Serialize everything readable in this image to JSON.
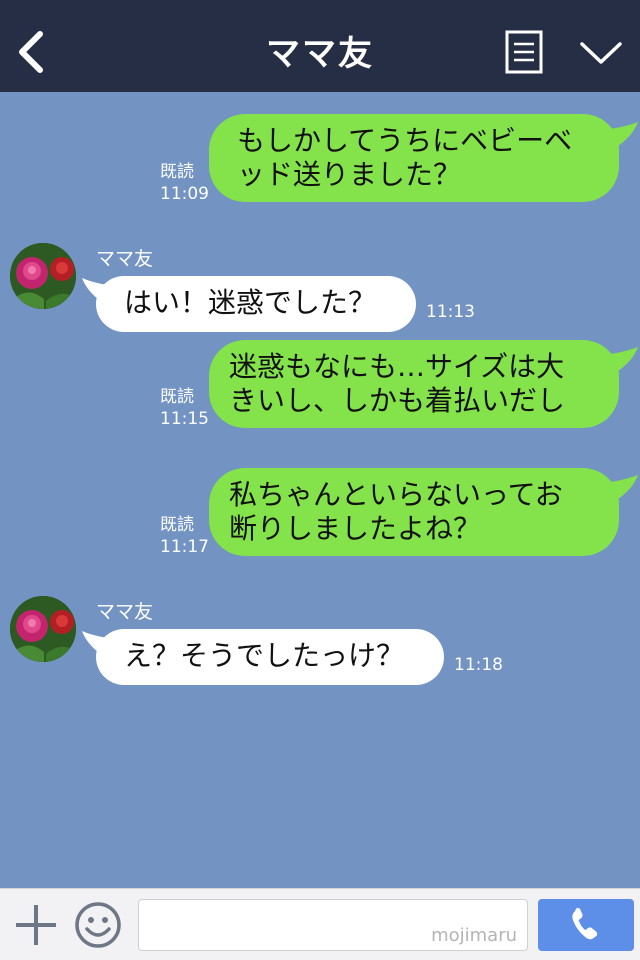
{
  "header": {
    "title": "ママ友"
  },
  "messages": [
    {
      "type": "sent",
      "lines": [
        "もしかしてうちにベビーベ",
        "ッド送りました？"
      ],
      "read_label": "既読",
      "time": "11:09"
    },
    {
      "type": "received",
      "sender": "ママ友",
      "lines": [
        "はい！迷惑でした？"
      ],
      "time": "11:13"
    },
    {
      "type": "sent",
      "lines": [
        "迷惑もなにも…サイズは大",
        "きいし、しかも着払いだし"
      ],
      "read_label": "既読",
      "time": "11:15"
    },
    {
      "type": "sent",
      "lines": [
        "私ちゃんといらないってお",
        "断りしましたよね？"
      ],
      "read_label": "既読",
      "time": "11:17"
    },
    {
      "type": "received",
      "sender": "ママ友",
      "lines": [
        "え？そうでしたっけ？"
      ],
      "time": "11:18"
    }
  ],
  "footer": {
    "watermark": "mojimaru"
  },
  "icons": {
    "back": "chevron-left-icon",
    "menu": "list-icon",
    "collapse": "chevron-down-icon",
    "plus": "plus-icon",
    "emoji": "smiley-icon",
    "call": "phone-icon"
  },
  "colors": {
    "header_bg": "#252e44",
    "chat_bg": "#7393c3",
    "sent_bubble": "#84e24a",
    "received_bubble": "#ffffff",
    "call_button": "#5d8ee8"
  }
}
